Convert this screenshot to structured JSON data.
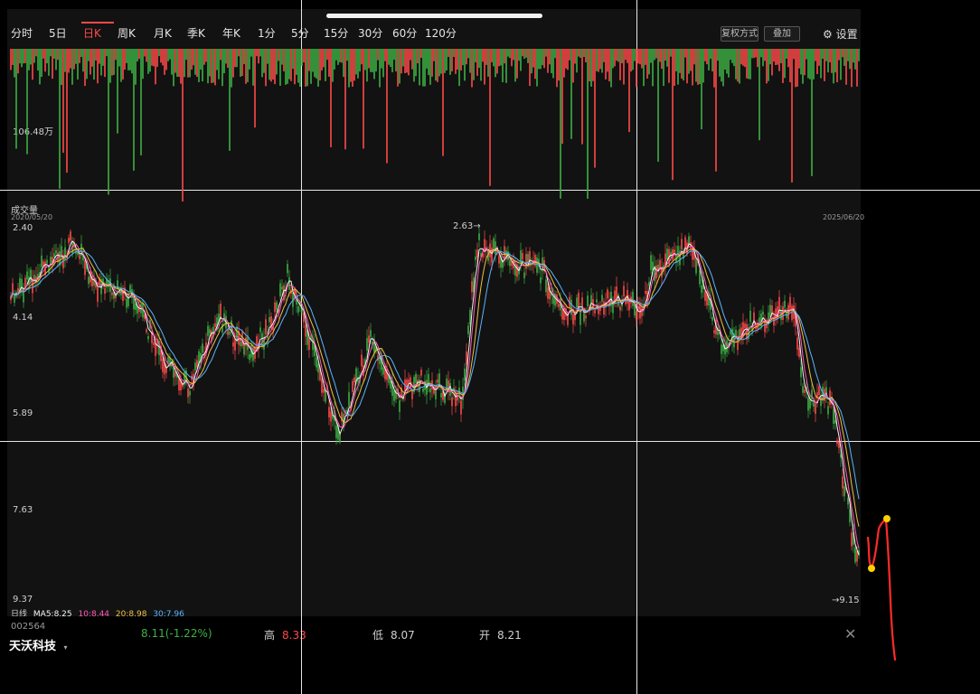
{
  "tabs": [
    {
      "label": "分时",
      "active": false
    },
    {
      "label": "5日",
      "active": false
    },
    {
      "label": "日K",
      "active": true
    },
    {
      "label": "周K",
      "active": false
    },
    {
      "label": "月K",
      "active": false
    },
    {
      "label": "季K",
      "active": false
    },
    {
      "label": "年K",
      "active": false
    },
    {
      "label": "1分",
      "active": false
    },
    {
      "label": "5分",
      "active": false
    },
    {
      "label": "15分",
      "active": false
    },
    {
      "label": "30分",
      "active": false
    },
    {
      "label": "60分",
      "active": false
    },
    {
      "label": "120分",
      "active": false
    }
  ],
  "header": {
    "btn_left": "复权方式",
    "btn_right": "叠加",
    "settings_label": "设置",
    "settings_icon": "gear-icon"
  },
  "volume": {
    "max_label": "106.48万",
    "title": "成交量"
  },
  "price_axis": {
    "top": "2.40",
    "labels": [
      "4.14",
      "5.89",
      "7.63",
      "9.37"
    ],
    "high_marker": "2.63→",
    "low_marker": "→9.15"
  },
  "dates": {
    "start": "2020/05/20",
    "end": "2025/06/20"
  },
  "ma_legend": {
    "prefix": "日线",
    "ma5": "MA5:8.25",
    "ma10": "10:8.44",
    "ma20": "20:8.98",
    "ma30": "30:7.96"
  },
  "stock": {
    "name": "天沃科技",
    "code": "002564"
  },
  "quote": {
    "open_label": "开",
    "open_value": "8.21",
    "low_label": "低",
    "low_value": "8.07",
    "high_label": "高",
    "high_value": "8.33",
    "last_value": "8.11(-1.22%)"
  },
  "colors": {
    "up": "#ff4a4a",
    "down": "#3cb043",
    "ma5": "#f5f5f5",
    "ma10": "#ff5ab4",
    "ma20": "#f0c040",
    "ma30": "#5ab4ff",
    "annotation": "#ff2a2a"
  }
}
